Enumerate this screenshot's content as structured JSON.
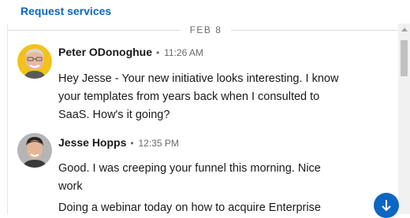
{
  "header": {
    "request_services": "Request services"
  },
  "date_divider": "FEB 8",
  "messages": [
    {
      "sender": "Peter ODonoghue",
      "time": "11:26 AM",
      "body": "Hey Jesse - Your new initiative looks interesting. I know your templates from years back when I consulted to SaaS. How's it going?"
    },
    {
      "sender": "Jesse Hopps",
      "time": "12:35 PM",
      "body": "Good. I was creeping your funnel this morning. Nice work",
      "body2": "Doing a webinar today on how to acquire Enterprise"
    }
  ],
  "bullet": "•",
  "colors": {
    "link": "#0a66c2",
    "fab": "#0a66c2"
  },
  "icons": {
    "scroll_down": "arrow-down-icon"
  }
}
